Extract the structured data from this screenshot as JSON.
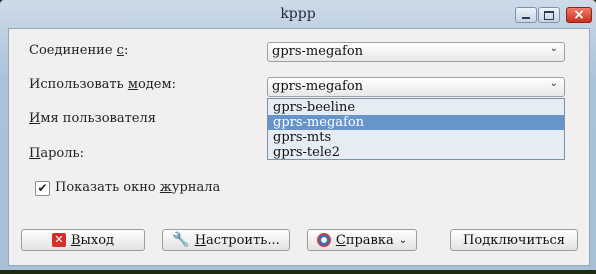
{
  "window": {
    "title": "kppp"
  },
  "form": {
    "connection_label_pre": "Соединение ",
    "connection_label_mnemonic": "с",
    "connection_label_post": ":",
    "connection_value": "gprs-megafon",
    "modem_label_pre": "Использовать ",
    "modem_label_mnemonic": "м",
    "modem_label_post": "одем:",
    "modem_value": "gprs-megafon",
    "modem_options": [
      "gprs-beeline",
      "gprs-megafon",
      "gprs-mts",
      "gprs-tele2"
    ],
    "modem_selected_index": 1,
    "username_label_mnemonic": "И",
    "username_label_post": "мя пользователя",
    "password_label_mnemonic": "П",
    "password_label_post": "ароль:",
    "show_log_label_pre": "Показать окно ",
    "show_log_label_mnemonic": "ж",
    "show_log_label_post": "урнала",
    "show_log_checked": "✔"
  },
  "buttons": {
    "quit_mnemonic": "В",
    "quit_post": "ыход",
    "setup_mnemonic": "Н",
    "setup_post": "астроить...",
    "help_mnemonic": "С",
    "help_post": "правка",
    "connect_label": "Подключиться"
  },
  "icons": {
    "close": "close-icon",
    "wrench": "wrench-icon",
    "help": "help-icon",
    "dropdown": "chevron-down-icon"
  }
}
